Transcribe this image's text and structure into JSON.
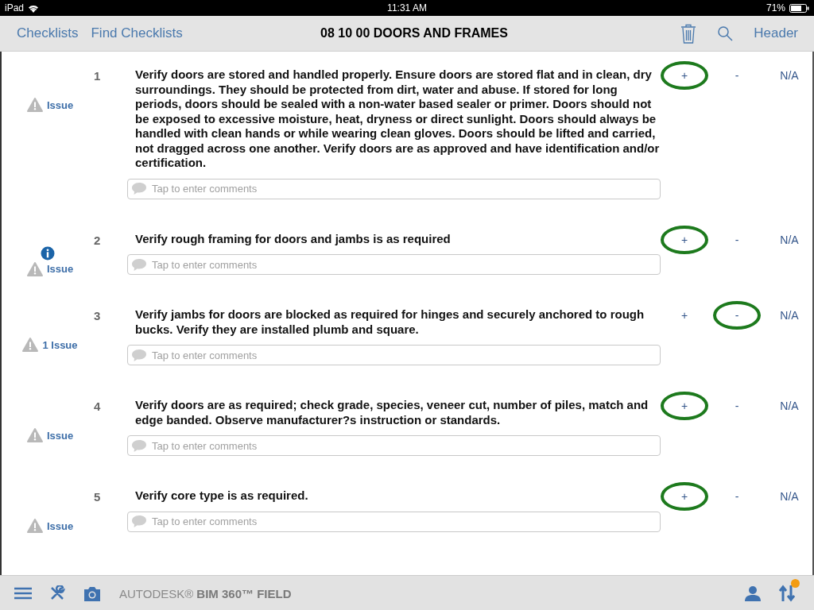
{
  "status_bar": {
    "device": "iPad",
    "time": "11:31 AM",
    "battery": "71%"
  },
  "nav": {
    "back": "Checklists",
    "find": "Find Checklists",
    "title": "08 10 00 DOORS AND FRAMES",
    "header_button": "Header"
  },
  "items": [
    {
      "number": "1",
      "info": false,
      "issue": "Issue",
      "text": "Verify doors are stored and handled properly. Ensure doors are stored flat and in clean, dry surroundings. They should be protected from dirt, water and abuse. If stored for long periods, doors should be sealed with a non-water based sealer or primer. Doors should not be exposed to excessive moisture, heat, dryness or direct sunlight. Doors should always be handled with clean hands or while wearing clean gloves. Doors should be lifted and carried, not dragged across one another. Verify doors are as approved and have identification and/or certification.",
      "comment_placeholder": "Tap to enter comments",
      "responses": [
        {
          "label": "+",
          "selected": true
        },
        {
          "label": "-",
          "selected": false
        },
        {
          "label": "N/A",
          "selected": false
        }
      ]
    },
    {
      "number": "2",
      "info": true,
      "issue": "Issue",
      "text": "Verify rough framing for doors and jambs is as required",
      "comment_placeholder": "Tap to enter comments",
      "responses": [
        {
          "label": "+",
          "selected": true
        },
        {
          "label": "-",
          "selected": false
        },
        {
          "label": "N/A",
          "selected": false
        }
      ]
    },
    {
      "number": "3",
      "info": false,
      "issue": "1 Issue",
      "text": "Verify jambs for doors are blocked as required for hinges and securely anchored to rough bucks. Verify they are installed plumb and square.",
      "comment_placeholder": "Tap to enter comments",
      "responses": [
        {
          "label": "+",
          "selected": false
        },
        {
          "label": "-",
          "selected": true
        },
        {
          "label": "N/A",
          "selected": false
        }
      ]
    },
    {
      "number": "4",
      "info": false,
      "issue": "Issue",
      "text": "Verify doors are as required; check grade, species, veneer cut, number of piles, match and edge banded. Observe manufacturer?s instruction or standards.",
      "comment_placeholder": "Tap to enter comments",
      "responses": [
        {
          "label": "+",
          "selected": true
        },
        {
          "label": "-",
          "selected": false
        },
        {
          "label": "N/A",
          "selected": false
        }
      ]
    },
    {
      "number": "5",
      "info": false,
      "issue": "Issue",
      "text": "Verify core type is as required.",
      "comment_placeholder": "Tap to enter comments",
      "responses": [
        {
          "label": "+",
          "selected": true
        },
        {
          "label": "-",
          "selected": false
        },
        {
          "label": "N/A",
          "selected": false
        }
      ]
    }
  ],
  "footer": {
    "brand": "AUTODESK®",
    "product": "BIM 360™ FIELD"
  }
}
